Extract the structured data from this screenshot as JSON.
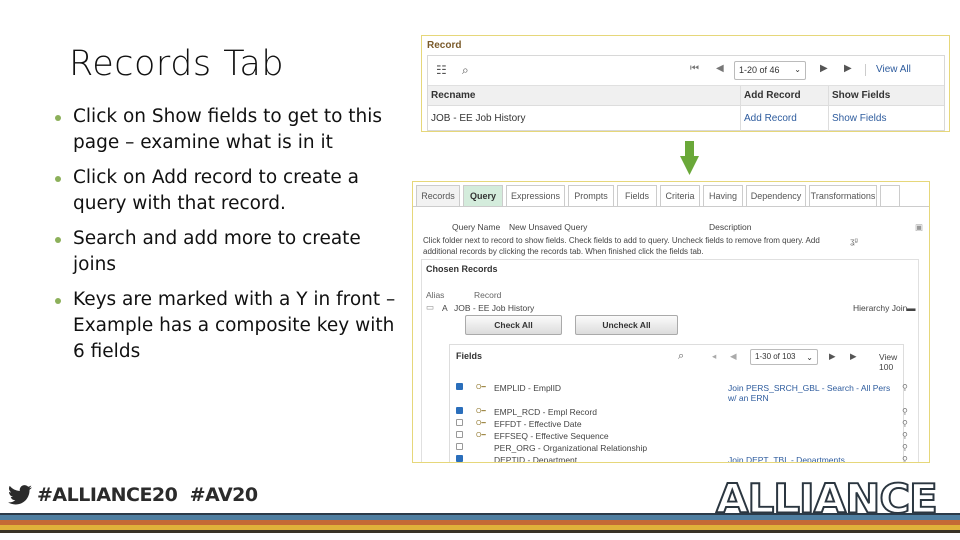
{
  "slide": {
    "title": "Records Tab",
    "bullets": [
      "Click on Show fields to get to this page – examine what is in it",
      "Click on Add record to create a query with that record.",
      "Search and add more to create joins",
      "Keys are marked with a Y in front – Example has a composite key with 6 fields"
    ]
  },
  "record_panel": {
    "header": "Record",
    "pager": "1-20 of 46",
    "view_all": "View All",
    "columns": [
      "Recname",
      "Add Record",
      "Show Fields"
    ],
    "rows": [
      {
        "recname": "JOB - EE Job History",
        "add": "Add Record",
        "show": "Show Fields"
      }
    ]
  },
  "query_panel": {
    "tabs": [
      "Records",
      "Query",
      "Expressions",
      "Prompts",
      "Fields",
      "Criteria",
      "Having",
      "Dependency",
      "Transformations"
    ],
    "active_tab": "Query",
    "query_name_label": "Query Name",
    "query_name_value": "New Unsaved Query",
    "description_label": "Description",
    "instructions": "Click folder next to record to show fields. Check fields to add to query. Uncheck fields to remove from query. Add additional records by clicking the records tab. When finished click the fields tab.",
    "chosen_records_label": "Chosen Records",
    "alias_label": "Alias",
    "record_label": "Record",
    "chosen_alias": "A",
    "chosen_record": "JOB - EE Job History",
    "hierarchy_join": "Hierarchy Join",
    "check_all": "Check All",
    "uncheck_all": "Uncheck All",
    "fields_label": "Fields",
    "fields_pager": "1-30 of 103",
    "view_100": "View 100",
    "fields": [
      {
        "checked": true,
        "key": true,
        "name": "EMPLID - EmplID",
        "join": "Join PERS_SRCH_GBL - Search - All Pers w/ an ERN"
      },
      {
        "checked": true,
        "key": true,
        "name": "EMPL_RCD - Empl Record",
        "join": ""
      },
      {
        "checked": false,
        "key": true,
        "name": "EFFDT - Effective Date",
        "join": ""
      },
      {
        "checked": false,
        "key": true,
        "name": "EFFSEQ - Effective Sequence",
        "join": ""
      },
      {
        "checked": false,
        "key": false,
        "name": "PER_ORG - Organizational Relationship",
        "join": ""
      },
      {
        "checked": true,
        "key": false,
        "name": "DEPTID - Department",
        "join": "Join DEPT_TBL - Departments"
      }
    ]
  },
  "footer": {
    "hashtags": "#ALLIANCE20  #AV20",
    "logo": "ALLIANCE",
    "stripe_colors": [
      "#2b3a48",
      "#4f7ea0",
      "#c46a35",
      "#e0b13a",
      "#3a3326"
    ]
  },
  "colors": {
    "bullet": "#8cb05a",
    "arrow": "#6aa839",
    "link": "#2e5c9e",
    "panel_border": "#e6d77a"
  }
}
